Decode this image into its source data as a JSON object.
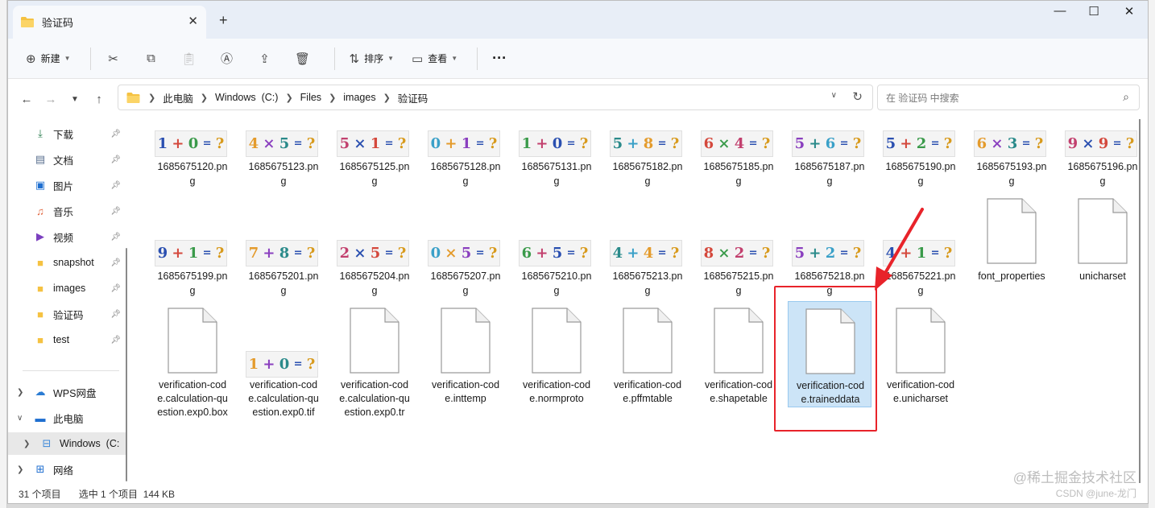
{
  "window": {
    "tab_title": "验证码",
    "tab_close": "✕",
    "new_tab": "+",
    "minimize": "—",
    "maximize": "☐",
    "close": "✕"
  },
  "toolbar": {
    "new_label": "新建",
    "sort_label": "排序",
    "view_label": "查看",
    "more_label": "···"
  },
  "address": {
    "crumbs": [
      "此电脑",
      "Windows  (C:)",
      "Files",
      "images",
      "验证码"
    ]
  },
  "search": {
    "placeholder": "在 验证码 中搜索"
  },
  "sidebar": {
    "quick": [
      {
        "label": "下载",
        "icon": "download-icon"
      },
      {
        "label": "文档",
        "icon": "document-icon"
      },
      {
        "label": "图片",
        "icon": "picture-icon"
      },
      {
        "label": "音乐",
        "icon": "music-icon"
      },
      {
        "label": "视频",
        "icon": "video-icon"
      },
      {
        "label": "snapshot",
        "icon": "folder-icon"
      },
      {
        "label": "images",
        "icon": "folder-icon"
      },
      {
        "label": "验证码",
        "icon": "folder-icon"
      },
      {
        "label": "test",
        "icon": "folder-icon"
      }
    ],
    "tree": [
      {
        "label": "WPS网盘",
        "icon": "cloud-icon"
      },
      {
        "label": "此电脑",
        "icon": "computer-icon"
      },
      {
        "label": "Windows  (C:",
        "icon": "drive-icon"
      },
      {
        "label": "网络",
        "icon": "network-icon"
      }
    ]
  },
  "files": {
    "row1": [
      {
        "n1": "1685675120.pn",
        "n2": "g",
        "chars": [
          "1",
          "+",
          "0",
          "=",
          "?"
        ]
      },
      {
        "n1": "1685675123.pn",
        "n2": "g",
        "chars": [
          "4",
          "×",
          "5",
          "=",
          "?"
        ]
      },
      {
        "n1": "1685675125.pn",
        "n2": "g",
        "chars": [
          "5",
          "×",
          "1",
          "=",
          "?"
        ]
      },
      {
        "n1": "1685675128.pn",
        "n2": "g",
        "chars": [
          "0",
          "+",
          "1",
          "=",
          "?"
        ]
      },
      {
        "n1": "1685675131.pn",
        "n2": "g",
        "chars": [
          "1",
          "+",
          "0",
          "=",
          "?"
        ]
      },
      {
        "n1": "1685675182.pn",
        "n2": "g",
        "chars": [
          "5",
          "+",
          "8",
          "=",
          "?"
        ]
      },
      {
        "n1": "1685675185.pn",
        "n2": "g",
        "chars": [
          "6",
          "×",
          "4",
          "=",
          "?"
        ]
      },
      {
        "n1": "1685675187.pn",
        "n2": "g",
        "chars": [
          "5",
          "+",
          "6",
          "=",
          "?"
        ]
      },
      {
        "n1": "1685675190.pn",
        "n2": "g",
        "chars": [
          "5",
          "+",
          "2",
          "=",
          "?"
        ]
      },
      {
        "n1": "1685675193.pn",
        "n2": "g",
        "chars": [
          "6",
          "×",
          "3",
          "=",
          "?"
        ]
      },
      {
        "n1": "1685675196.pn",
        "n2": "g",
        "chars": [
          "9",
          "×",
          "9",
          "=",
          "?"
        ]
      }
    ],
    "row2": [
      {
        "n1": "1685675199.pn",
        "n2": "g",
        "chars": [
          "9",
          "+",
          "1",
          "=",
          "?"
        ]
      },
      {
        "n1": "1685675201.pn",
        "n2": "g",
        "chars": [
          "7",
          "+",
          "8",
          "=",
          "?"
        ]
      },
      {
        "n1": "1685675204.pn",
        "n2": "g",
        "chars": [
          "2",
          "×",
          "5",
          "=",
          "?"
        ]
      },
      {
        "n1": "1685675207.pn",
        "n2": "g",
        "chars": [
          "0",
          "×",
          "5",
          "=",
          "?"
        ]
      },
      {
        "n1": "1685675210.pn",
        "n2": "g",
        "chars": [
          "6",
          "+",
          "5",
          "=",
          "?"
        ]
      },
      {
        "n1": "1685675213.pn",
        "n2": "g",
        "chars": [
          "4",
          "+",
          "4",
          "=",
          "?"
        ]
      },
      {
        "n1": "1685675215.pn",
        "n2": "g",
        "chars": [
          "8",
          "×",
          "2",
          "=",
          "?"
        ]
      },
      {
        "n1": "1685675218.pn",
        "n2": "g",
        "chars": [
          "5",
          "+",
          "2",
          "=",
          "?"
        ]
      },
      {
        "n1": "1685675221.pn",
        "n2": "g",
        "chars": [
          "4",
          "+",
          "1",
          "=",
          "?"
        ]
      },
      {
        "n1": "font_properties",
        "n2": "",
        "chars": []
      },
      {
        "n1": "unicharset",
        "n2": "",
        "chars": []
      }
    ],
    "row3": [
      {
        "l1": "verification-cod",
        "l2": "e.calculation-qu",
        "l3": "estion.exp0.box"
      },
      {
        "l1": "verification-cod",
        "l2": "e.calculation-qu",
        "l3": "estion.exp0.tif",
        "chars": [
          "1",
          "+",
          "0",
          "=",
          "?"
        ]
      },
      {
        "l1": "verification-cod",
        "l2": "e.calculation-qu",
        "l3": "estion.exp0.tr"
      },
      {
        "l1": "verification-cod",
        "l2": "e.inttemp",
        "l3": ""
      },
      {
        "l1": "verification-cod",
        "l2": "e.normproto",
        "l3": ""
      },
      {
        "l1": "verification-cod",
        "l2": "e.pffmtable",
        "l3": ""
      },
      {
        "l1": "verification-cod",
        "l2": "e.shapetable",
        "l3": ""
      },
      {
        "l1": "verification-cod",
        "l2": "e.traineddata",
        "l3": ""
      },
      {
        "l1": "verification-cod",
        "l2": "e.unicharset",
        "l3": ""
      }
    ]
  },
  "status": {
    "count": "31 个项目",
    "selected": "选中 1 个项目  144 KB"
  },
  "watermark": {
    "line1": "@稀土掘金技术社区",
    "line2": "CSDN @june-龙门"
  },
  "colors": {
    "accent": "#0067c0",
    "selection": "#cce4f7",
    "annotation_red": "#e8232a",
    "folder": "#f5c242"
  }
}
